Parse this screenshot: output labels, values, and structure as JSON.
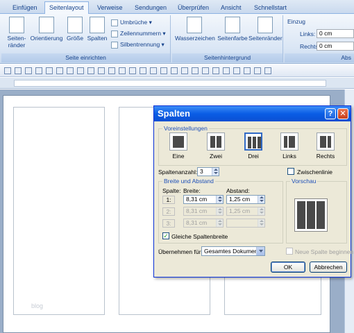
{
  "ribbon": {
    "tabs": [
      {
        "label": "Einfügen"
      },
      {
        "label": "Seitenlayout"
      },
      {
        "label": "Verweise"
      },
      {
        "label": "Sendungen"
      },
      {
        "label": "Überprüfen"
      },
      {
        "label": "Ansicht"
      },
      {
        "label": "Schnellstart"
      }
    ],
    "active_tab": "Seitenlayout",
    "page_setup": {
      "caption": "Seite einrichten",
      "margins_label_line1": "Seiten-",
      "margins_label_line2": "ränder",
      "orientation_label": "Orientierung",
      "size_label": "Größe",
      "columns_label": "Spalten",
      "breaks_label": "Umbrüche",
      "line_numbers_label": "Zeilennummern",
      "hyphenation_label": "Silbentrennung"
    },
    "page_background": {
      "caption": "Seitenhintergrund",
      "watermark_label": "Wasserzeichen",
      "page_color_label": "Seitenfarbe",
      "page_borders_label": "Seitenränder"
    },
    "indent": {
      "caption_partial": "Abs",
      "title": "Einzug",
      "left_label": "Links:",
      "left_value": "0 cm",
      "right_label": "Rechts:",
      "right_value": "0 cm"
    }
  },
  "document": {
    "watermark_text": "blog"
  },
  "dialog": {
    "title": "Spalten",
    "help_glyph": "?",
    "close_glyph": "✕",
    "presets_legend": "Voreinstellungen",
    "presets": [
      {
        "label": "Eine"
      },
      {
        "label": "Zwei"
      },
      {
        "label": "Drei"
      },
      {
        "label": "Links"
      },
      {
        "label": "Rechts"
      }
    ],
    "selected_preset": "Drei",
    "column_count_label": "Spaltenanzahl:",
    "column_count_value": "3",
    "line_between_label": "Zwischenlinie",
    "line_between_checked": false,
    "width_spacing_legend": "Breite und Abstand",
    "preview_legend": "Vorschau",
    "col_header": "Spalte:",
    "width_header": "Breite:",
    "spacing_header": "Abstand:",
    "rows": [
      {
        "col": "1:",
        "width": "8,31 cm",
        "spacing": "1,25 cm",
        "enabled": true
      },
      {
        "col": "2:",
        "width": "8,31 cm",
        "spacing": "1,25 cm",
        "enabled": false
      },
      {
        "col": "3:",
        "width": "8,31 cm",
        "spacing": "",
        "enabled": false
      }
    ],
    "equal_width_label": "Gleiche Spaltenbreite",
    "equal_width_checked": true,
    "apply_to_label": "Übernehmen für:",
    "apply_to_value": "Gesamtes Dokument",
    "new_column_label": "Neue Spalte beginnen",
    "new_column_checked": false,
    "ok_label": "OK",
    "cancel_label": "Abbrechen"
  }
}
